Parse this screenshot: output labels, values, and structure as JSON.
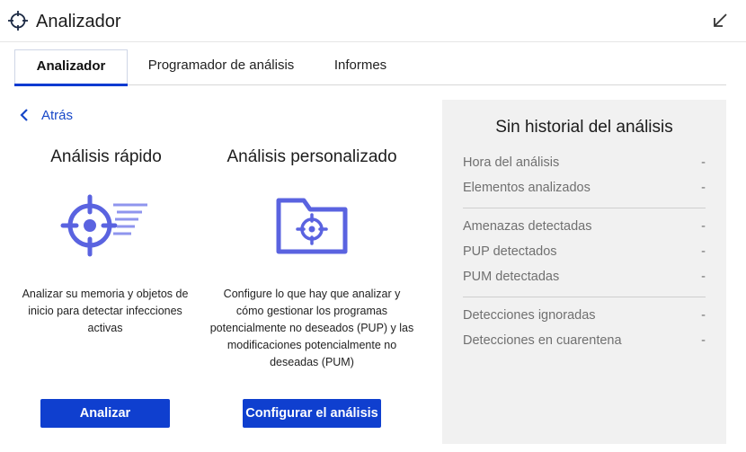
{
  "window": {
    "title": "Analizador",
    "app_icon": "crosshair-icon",
    "minimize_icon": "arrow-down-left-icon"
  },
  "tabs": [
    {
      "label": "Analizador",
      "active": true
    },
    {
      "label": "Programador de análisis",
      "active": false
    },
    {
      "label": "Informes",
      "active": false
    }
  ],
  "back": {
    "label": "Atrás",
    "icon": "chevron-left-icon"
  },
  "quick_scan": {
    "title": "Análisis rápido",
    "icon": "crosshair-scan-icon",
    "description": "Analizar su memoria y objetos de inicio para detectar infecciones activas",
    "button_label": "Analizar"
  },
  "custom_scan": {
    "title": "Análisis personalizado",
    "icon": "folder-crosshair-icon",
    "description": "Configure lo que hay que analizar y cómo gestionar los programas potencialmente no deseados (PUP) y las modificaciones potencialmente no deseadas (PUM)",
    "button_label": "Configurar el análisis"
  },
  "history": {
    "title": "Sin historial del análisis",
    "rows": [
      {
        "label": "Hora del análisis",
        "value": "-"
      },
      {
        "label": "Elementos analizados",
        "value": "-"
      },
      {
        "label": "Amenazas detectadas",
        "value": "-"
      },
      {
        "label": "PUP detectados",
        "value": "-"
      },
      {
        "label": "PUM detectadas",
        "value": "-"
      },
      {
        "label": "Detecciones ignoradas",
        "value": "-"
      },
      {
        "label": "Detecciones en cuarentena",
        "value": "-"
      }
    ]
  },
  "colors": {
    "accent": "#0f3fcf",
    "icon_purple": "#5a63e0",
    "link": "#1848c8",
    "panel_bg": "#f1f1f1"
  }
}
